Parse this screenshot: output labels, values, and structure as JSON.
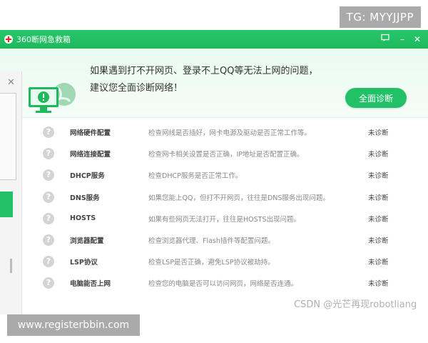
{
  "watermark_tag": "TG: MYYJJPP",
  "window": {
    "title": "360断网急救箱",
    "feedback_icon": "feedback-icon",
    "minimize_label": "–",
    "close_label": "✕"
  },
  "banner": {
    "line1": "如果遇到打不开网页、登录不上QQ等无法上网的问题，",
    "line2": "建议您全面诊断网络！",
    "button_label": "全面诊断"
  },
  "items": [
    {
      "name": "网络硬件配置",
      "desc": "检查网线是否插好，网卡电源及驱动是否正常工作等。",
      "status": "未诊断"
    },
    {
      "name": "网络连接配置",
      "desc": "检查网卡相关设置是否正确，IP地址是否配置正确。",
      "status": "未诊断"
    },
    {
      "name": "DHCP服务",
      "desc": "检查DHCP服务是否正常工作。",
      "status": "未诊断"
    },
    {
      "name": "DNS服务",
      "desc": "如果您能上QQ，但打不开网页，往往是DNS服务出现问题。",
      "status": "未诊断"
    },
    {
      "name": "HOSTS",
      "desc": "如果有些网页无法打开，往往是HOSTS出现问题。",
      "status": "未诊断"
    },
    {
      "name": "浏览器配置",
      "desc": "检查浏览器代理、Flash插件等配置问题。",
      "status": "未诊断"
    },
    {
      "name": "LSP协议",
      "desc": "检查LSP是否正确，避免LSP协议被劫持。",
      "status": "未诊断"
    },
    {
      "name": "电脑能否上网",
      "desc": "检查您的电脑是否可以访问网页，网络是否连通。",
      "status": "未诊断"
    }
  ],
  "question_mark": "?",
  "bg_window_close": "✕",
  "csdn_credit": "CSDN @光芒再现robotliang",
  "watermark_site": "www.registerbbin.com",
  "colors": {
    "accent": "#22c168",
    "titlebar": "#27c66a"
  }
}
